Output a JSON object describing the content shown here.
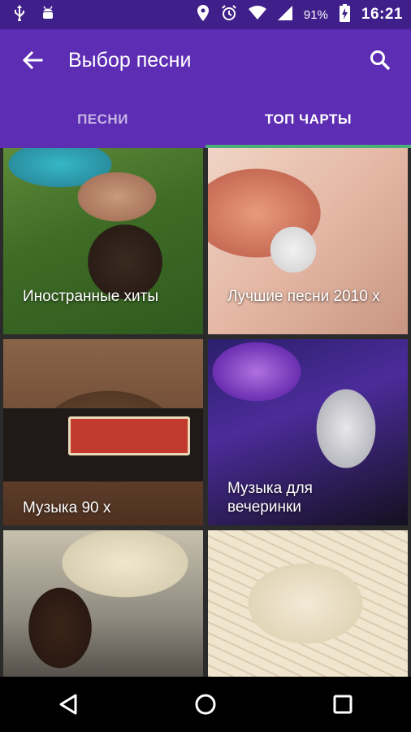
{
  "status_bar": {
    "battery_percent": "91%",
    "time": "16:21",
    "icons": [
      "usb-icon",
      "android-debug-icon",
      "location-icon",
      "alarm-icon",
      "wifi-icon",
      "signal-icon",
      "battery-charging-icon"
    ]
  },
  "app_bar": {
    "title": "Выбор песни",
    "back_icon": "arrow-back-icon",
    "search_icon": "search-icon"
  },
  "tabs": [
    {
      "label": "ПЕСНИ",
      "active": false
    },
    {
      "label": "ТОП ЧАРТЫ",
      "active": true
    }
  ],
  "tiles": [
    {
      "caption": "Иностранные хиты"
    },
    {
      "caption": "Лучшие песни 2010 х"
    },
    {
      "caption": "Музыка 90 х"
    },
    {
      "caption": "Музыка для вечеринки"
    },
    {
      "caption": ""
    },
    {
      "caption": ""
    }
  ],
  "colors": {
    "status_bar": "#3f1f8a",
    "primary": "#5d2db3",
    "tab_indicator": "#4caf7a"
  }
}
